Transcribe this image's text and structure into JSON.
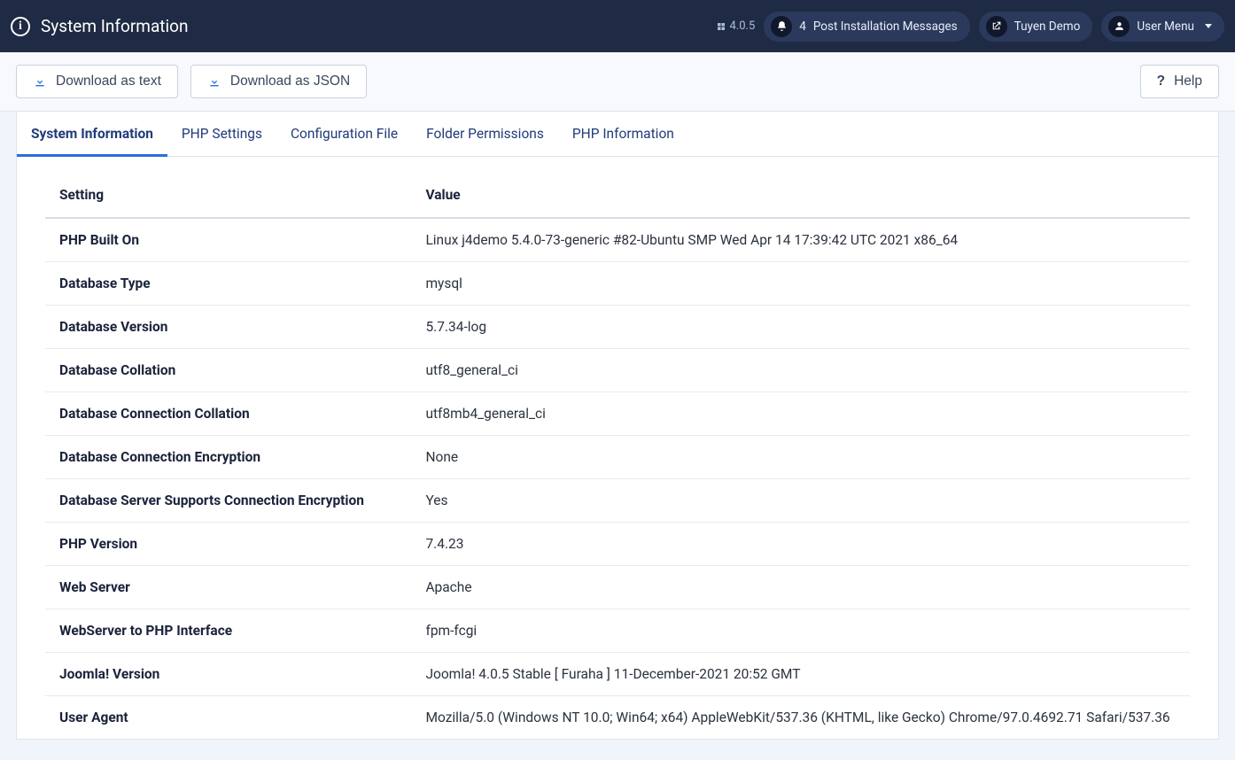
{
  "header": {
    "title": "System Information",
    "version": "4.0.5",
    "messages_count": "4",
    "messages_label": "Post Installation Messages",
    "site_label": "Tuyen Demo",
    "user_menu_label": "User Menu"
  },
  "toolbar": {
    "download_text": "Download as text",
    "download_json": "Download as JSON",
    "help": "Help"
  },
  "tabs": [
    "System Information",
    "PHP Settings",
    "Configuration File",
    "Folder Permissions",
    "PHP Information"
  ],
  "table": {
    "headers": {
      "setting": "Setting",
      "value": "Value"
    },
    "rows": [
      {
        "setting": "PHP Built On",
        "value": "Linux j4demo 5.4.0-73-generic #82-Ubuntu SMP Wed Apr 14 17:39:42 UTC 2021 x86_64"
      },
      {
        "setting": "Database Type",
        "value": "mysql"
      },
      {
        "setting": "Database Version",
        "value": "5.7.34-log"
      },
      {
        "setting": "Database Collation",
        "value": "utf8_general_ci"
      },
      {
        "setting": "Database Connection Collation",
        "value": "utf8mb4_general_ci"
      },
      {
        "setting": "Database Connection Encryption",
        "value": "None"
      },
      {
        "setting": "Database Server Supports Connection Encryption",
        "value": "Yes"
      },
      {
        "setting": "PHP Version",
        "value": "7.4.23"
      },
      {
        "setting": "Web Server",
        "value": "Apache"
      },
      {
        "setting": "WebServer to PHP Interface",
        "value": "fpm-fcgi"
      },
      {
        "setting": "Joomla! Version",
        "value": "Joomla! 4.0.5 Stable [ Furaha ] 11-December-2021 20:52 GMT"
      },
      {
        "setting": "User Agent",
        "value": "Mozilla/5.0 (Windows NT 10.0; Win64; x64) AppleWebKit/537.36 (KHTML, like Gecko) Chrome/97.0.4692.71 Safari/537.36"
      }
    ]
  }
}
